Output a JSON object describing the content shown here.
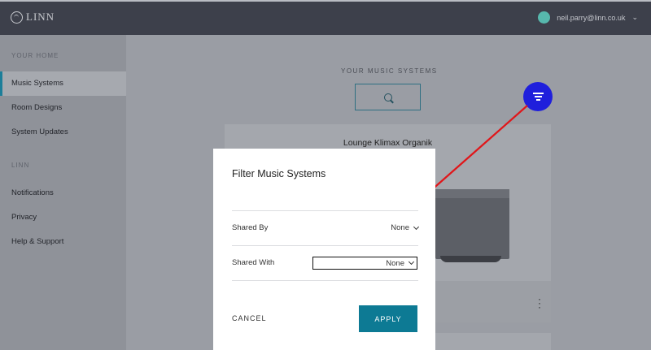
{
  "brand": {
    "name": "LINN"
  },
  "user": {
    "email": "neil.parry@linn.co.uk"
  },
  "sidebar": {
    "sections": [
      {
        "label": "YOUR HOME"
      },
      {
        "label": "LINN"
      }
    ],
    "items": [
      {
        "label": "Music Systems",
        "active": true
      },
      {
        "label": "Room Designs"
      },
      {
        "label": "System Updates"
      },
      {
        "label": "Notifications"
      },
      {
        "label": "Privacy"
      },
      {
        "label": "Help & Support"
      }
    ]
  },
  "main": {
    "title": "YOUR MUSIC SYSTEMS",
    "search_icon": "search-icon",
    "filter_icon": "filter-icon",
    "cards": [
      {
        "title": "Lounge Klimax Organik"
      }
    ]
  },
  "modal": {
    "title": "Filter Music Systems",
    "rows": [
      {
        "label": "Shared By",
        "value": "None"
      },
      {
        "label": "Shared With",
        "value": "None"
      }
    ],
    "cancel_label": "CANCEL",
    "apply_label": "APPLY"
  },
  "colors": {
    "accent": "#0d7a94",
    "annotation_circle": "#1f1fdc",
    "annotation_line": "#e0161a"
  }
}
